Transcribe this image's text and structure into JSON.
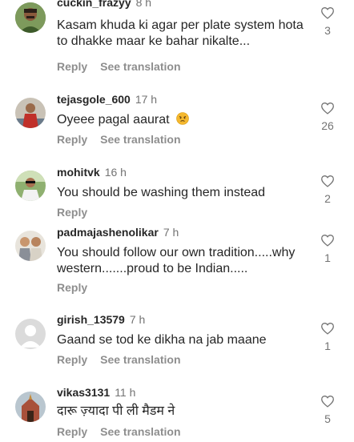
{
  "comments": [
    {
      "username": "cuckin_frazyy",
      "time": "8 h",
      "text": "Kasam khuda ki agar per plate system hota to dhakke maar ke bahar nikalte...",
      "reply": "Reply",
      "translate": "See translation",
      "likes": "3",
      "avatar": "avatar-photo-man-mustache"
    },
    {
      "username": "tejasgole_600",
      "time": "17 h",
      "text": "Oyeee pagal aaurat",
      "emoji": "angry-face-emoji",
      "reply": "Reply",
      "translate": "See translation",
      "likes": "26",
      "avatar": "avatar-photo-man-red-shirt"
    },
    {
      "username": "mohitvk",
      "time": "16 h",
      "text": "You should be washing them instead",
      "reply": "Reply",
      "likes": "2",
      "avatar": "avatar-photo-man-sunglasses"
    },
    {
      "username": "padmajashenolikar",
      "time": "7 h",
      "text": "You should follow our own tradition.....why western.......proud to be Indian.....",
      "reply": "Reply",
      "likes": "1",
      "avatar": "avatar-photo-two-women"
    },
    {
      "username": "girish_13579",
      "time": "7 h",
      "text": "Gaand se tod ke dikha na jab maane",
      "reply": "Reply",
      "translate": "See translation",
      "likes": "1",
      "avatar": "avatar-default-silhouette"
    },
    {
      "username": "vikas3131",
      "time": "11 h",
      "text": "दारू ज़्यादा पी ली मैडम ने",
      "reply": "Reply",
      "translate": "See translation",
      "likes": "5",
      "avatar": "avatar-photo-temple"
    }
  ]
}
